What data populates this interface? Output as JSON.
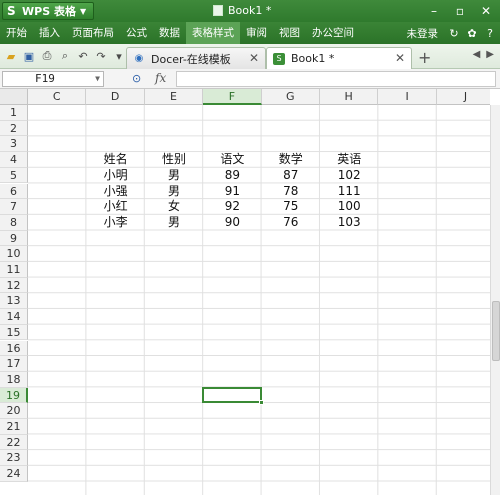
{
  "title_bar": {
    "app_name": "WPS 表格",
    "app_logo": "S",
    "document_title": "Book1 *",
    "window_controls": [
      "minimize-icon",
      "restore-icon",
      "close-icon"
    ]
  },
  "menu": {
    "items": [
      "开始",
      "插入",
      "页面布局",
      "公式",
      "数据",
      "表格样式",
      "审阅",
      "视图",
      "办公空间"
    ],
    "active": "表格样式",
    "login": "未登录"
  },
  "tabs": [
    {
      "label": "Docer-在线模板",
      "icon": "docer-icon"
    },
    {
      "label": "Book1 *",
      "icon": "spreadsheet-icon",
      "active": true
    }
  ],
  "formula_bar": {
    "cell_ref": "F19",
    "fx": "fx",
    "value": ""
  },
  "sheet": {
    "columns": [
      "C",
      "D",
      "E",
      "F",
      "G",
      "H",
      "I",
      "J"
    ],
    "selected_column": "F",
    "rows": [
      "1",
      "2",
      "3",
      "4",
      "5",
      "6",
      "7",
      "8",
      "9",
      "10",
      "11",
      "12",
      "13",
      "14",
      "15",
      "16",
      "17",
      "18",
      "19",
      "20",
      "21",
      "22",
      "23",
      "24"
    ],
    "selected_row": "19",
    "table": {
      "header": [
        "姓名",
        "性别",
        "语文",
        "数学",
        "英语"
      ],
      "records": [
        [
          "小明",
          "男",
          "89",
          "87",
          "102"
        ],
        [
          "小强",
          "男",
          "91",
          "78",
          "111"
        ],
        [
          "小红",
          "女",
          "92",
          "75",
          "100"
        ],
        [
          "小李",
          "男",
          "90",
          "76",
          "103"
        ]
      ]
    }
  },
  "colors": {
    "accent": "#2f7a2d",
    "selection": "#3a8a35"
  }
}
